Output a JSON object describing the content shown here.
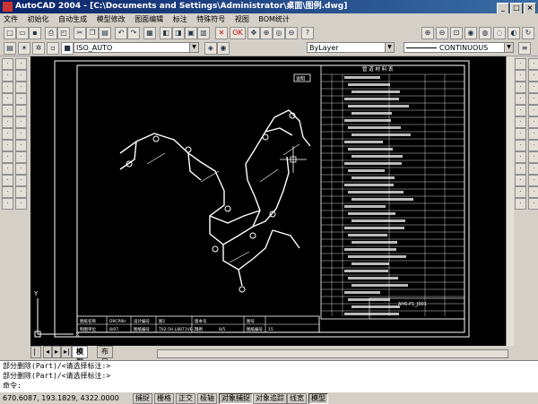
{
  "window": {
    "title": "AutoCAD 2004 - [C:\\Documents and Settings\\Administrator\\桌面\\图例.dwg]"
  },
  "menu": [
    "文件",
    "初始化",
    "自动生成",
    "模型修改",
    "图面编辑",
    "标注",
    "特殊符号",
    "视图",
    "BOM统计"
  ],
  "toolbar": {
    "layer_combo": "ISO_AUTO",
    "color_combo": "ByLayer",
    "linetype_combo": "CONTINUOUS",
    "text_icon": "OK"
  },
  "tabs": [
    "模型",
    "布局1"
  ],
  "command": {
    "lines": [
      "部分删除(Part)/<请选择标注:>",
      "部分删除(Part)/<请选择标注:>"
    ],
    "prompt": "命令:"
  },
  "status": {
    "coords": "670.6087, 193.1829, 4322.0000",
    "toggles": [
      {
        "label": "捕捉",
        "on": false
      },
      {
        "label": "栅格",
        "on": false
      },
      {
        "label": "正交",
        "on": false
      },
      {
        "label": "极轴",
        "on": false
      },
      {
        "label": "对象捕捉",
        "on": true
      },
      {
        "label": "对象追踪",
        "on": false
      },
      {
        "label": "线宽",
        "on": false
      },
      {
        "label": "模型",
        "on": true
      }
    ]
  },
  "drawing": {
    "title_block": {
      "r1": [
        "图纸名称",
        "DRCP8H",
        "设计编号",
        "图1",
        "版本号",
        "",
        "图号"
      ],
      "r2": [
        "制图单位",
        "8/07",
        "图纸编号",
        "T02-5H.L8871VE-71",
        "比例",
        "8/5",
        "",
        "图纸编号",
        "15"
      ]
    },
    "bom_header": "管  道  材  料  表",
    "drawing_no": "AH6-P1_J001",
    "callout": "说明"
  },
  "colors": {
    "canvas": "#000000",
    "title_bar": "#0a246a",
    "menu_bg": "#d4d0c8"
  }
}
